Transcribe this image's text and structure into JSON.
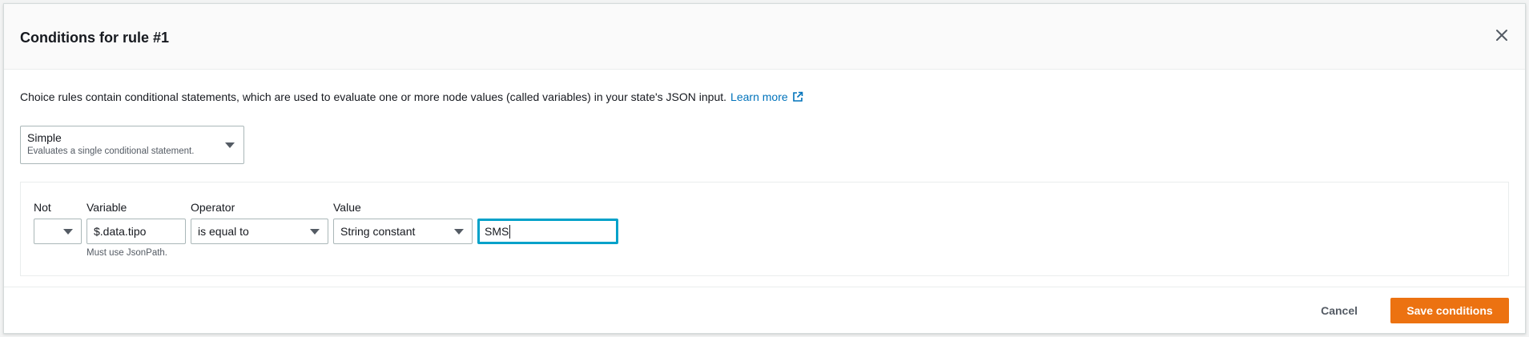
{
  "modal": {
    "title": "Conditions for rule #1",
    "close_icon": "close-icon"
  },
  "description": {
    "text": "Choice rules contain conditional statements, which are used to evaluate one or more node values (called variables) in your state's JSON input.",
    "link_label": "Learn more",
    "link_icon": "external-link-icon"
  },
  "rule_mode": {
    "selected": "Simple",
    "selected_description": "Evaluates a single conditional statement."
  },
  "condition": {
    "not": {
      "label": "Not",
      "value": ""
    },
    "variable": {
      "label": "Variable",
      "value": "$.data.tipo",
      "hint": "Must use JsonPath."
    },
    "operator": {
      "label": "Operator",
      "value": "is equal to"
    },
    "value": {
      "label": "Value",
      "type": "String constant",
      "input": "SMS"
    }
  },
  "footer": {
    "cancel_label": "Cancel",
    "save_label": "Save conditions"
  },
  "colors": {
    "primary_button": "#ec7211",
    "link": "#0073bb",
    "focus_border": "#00a1c9"
  }
}
